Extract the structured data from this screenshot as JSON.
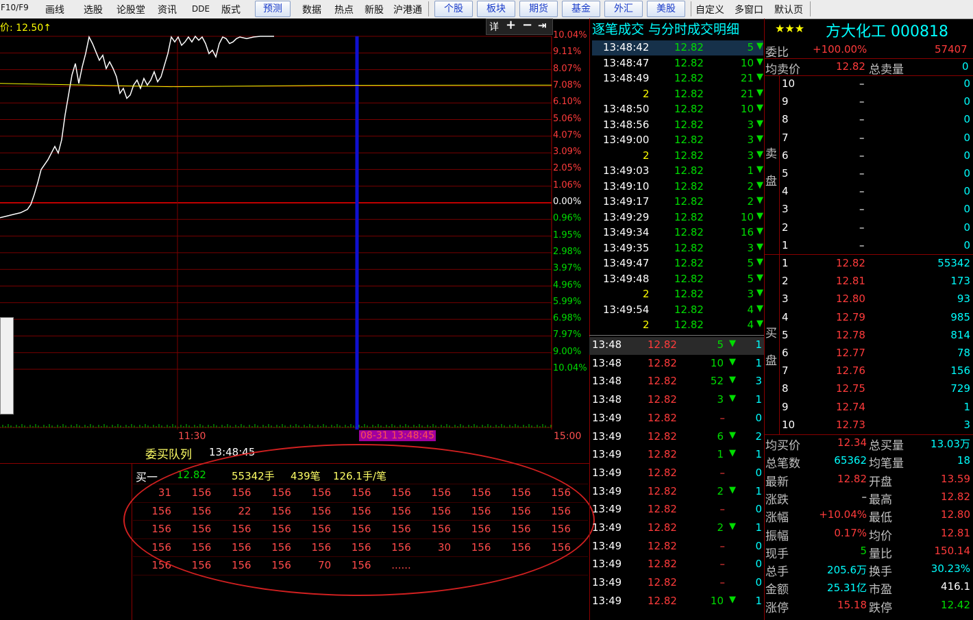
{
  "toolbar": {
    "items": [
      "F10/F9",
      "画线",
      "选股",
      "论股堂",
      "资讯",
      "DDE",
      "版式"
    ],
    "predict": "预测",
    "items2": [
      "数据",
      "热点",
      "新股",
      "沪港通"
    ],
    "tabs": [
      "个股",
      "板块",
      "期货",
      "基金",
      "外汇",
      "美股"
    ],
    "items3": [
      "自定义",
      "多窗口",
      "默认页"
    ]
  },
  "chart": {
    "price_label": "价: 12.50↑",
    "tools": [
      "详",
      "+",
      "−",
      "⇥"
    ],
    "time_labels": {
      "mid": "11:30",
      "cursor": "08-31 13:48:45",
      "end": "15:00"
    }
  },
  "chart_data": {
    "type": "line",
    "title": "",
    "y_pct_labels": [
      "10.04%",
      "9.11%",
      "8.07%",
      "7.08%",
      "6.10%",
      "5.06%",
      "4.07%",
      "3.09%",
      "2.05%",
      "1.06%",
      "0.00%",
      "0.96%",
      "1.95%",
      "2.98%",
      "3.97%",
      "4.96%",
      "5.99%",
      "6.98%",
      "7.97%",
      "9.00%",
      "10.04%"
    ],
    "x_labels": [
      "11:30",
      "15:00"
    ],
    "ylim": [
      -10.04,
      10.04
    ],
    "series": [
      {
        "name": "",
        "x": [
          0,
          10,
          20,
          30,
          40,
          45,
          50,
          55,
          60,
          70,
          80,
          85,
          90,
          95,
          100,
          105,
          110,
          115,
          120,
          125,
          130,
          135,
          140,
          145,
          150,
          155,
          160,
          165,
          170,
          175,
          180,
          185,
          190,
          195,
          200,
          205,
          210,
          215,
          220,
          225,
          230,
          235,
          240,
          245,
          250,
          255,
          260,
          265,
          270,
          275,
          280,
          285,
          290,
          295,
          300,
          305,
          310,
          315,
          320,
          325,
          330,
          335,
          340,
          345,
          350,
          360,
          370,
          380,
          390,
          400
        ],
        "values": [
          -0.9,
          -0.8,
          -0.7,
          -0.6,
          -0.4,
          -0.1,
          0.5,
          1.2,
          2.0,
          2.6,
          3.4,
          3.0,
          3.8,
          5.3,
          6.5,
          7.7,
          8.4,
          7.2,
          8.2,
          9.0,
          10.0,
          9.6,
          9.1,
          8.6,
          8.9,
          8.1,
          8.5,
          8.1,
          7.6,
          6.6,
          6.9,
          6.3,
          6.5,
          7.1,
          7.4,
          6.9,
          7.5,
          7.1,
          7.4,
          7.9,
          7.3,
          7.6,
          8.3,
          9.0,
          10.0,
          9.7,
          10.0,
          9.5,
          9.7,
          10.0,
          9.7,
          10.04,
          9.8,
          10.0,
          9.6,
          9.0,
          9.2,
          8.8,
          9.6,
          10.0,
          9.9,
          9.6,
          9.7,
          9.9,
          10.0,
          9.9,
          10.0,
          10.04,
          10.04,
          10.04
        ]
      },
      {
        "name": "",
        "x": [
          0,
          250,
          480,
          805
        ],
        "values": [
          7.2,
          7.0,
          7.08,
          7.1
        ]
      }
    ]
  },
  "queue": {
    "title": "委买队列",
    "time": "13:48:45",
    "label": "买一",
    "price": "12.82",
    "vol": "55342手",
    "count": "439笔",
    "avg": "126.1手/笔",
    "rows": [
      [
        "31",
        "156",
        "156",
        "156",
        "156",
        "156",
        "156",
        "156",
        "156",
        "156",
        "156"
      ],
      [
        "156",
        "156",
        "22",
        "156",
        "156",
        "156",
        "156",
        "156",
        "156",
        "156",
        "156"
      ],
      [
        "156",
        "156",
        "156",
        "156",
        "156",
        "156",
        "156",
        "156",
        "156",
        "156",
        "156"
      ],
      [
        "156",
        "156",
        "156",
        "156",
        "156",
        "156",
        "156",
        "30",
        "156",
        "156",
        "156"
      ],
      [
        "156",
        "156",
        "156",
        "156",
        "70",
        "156",
        "......"
      ]
    ]
  },
  "trades": {
    "header": "逐笔成交 与分时成交明细",
    "rows": [
      {
        "t": "13:48:42",
        "p": "12.82",
        "v": "5"
      },
      {
        "t": "13:48:47",
        "p": "12.82",
        "v": "10"
      },
      {
        "t": "13:48:49",
        "p": "12.82",
        "v": "21"
      },
      {
        "t": "2",
        "p": "12.82",
        "v": "21"
      },
      {
        "t": "13:48:50",
        "p": "12.82",
        "v": "10"
      },
      {
        "t": "13:48:56",
        "p": "12.82",
        "v": "3"
      },
      {
        "t": "13:49:00",
        "p": "12.82",
        "v": "3"
      },
      {
        "t": "2",
        "p": "12.82",
        "v": "3"
      },
      {
        "t": "13:49:03",
        "p": "12.82",
        "v": "1"
      },
      {
        "t": "13:49:10",
        "p": "12.82",
        "v": "2"
      },
      {
        "t": "13:49:17",
        "p": "12.82",
        "v": "2"
      },
      {
        "t": "13:49:29",
        "p": "12.82",
        "v": "10"
      },
      {
        "t": "13:49:34",
        "p": "12.82",
        "v": "16"
      },
      {
        "t": "13:49:35",
        "p": "12.82",
        "v": "3"
      },
      {
        "t": "13:49:47",
        "p": "12.82",
        "v": "5"
      },
      {
        "t": "13:49:48",
        "p": "12.82",
        "v": "5"
      },
      {
        "t": "2",
        "p": "12.82",
        "v": "3"
      },
      {
        "t": "13:49:54",
        "p": "12.82",
        "v": "4"
      },
      {
        "t": "2",
        "p": "12.82",
        "v": "4"
      }
    ],
    "minute_rows": [
      {
        "t": "13:48",
        "p": "12.82",
        "v": "5",
        "n": "1"
      },
      {
        "t": "13:48",
        "p": "12.82",
        "v": "10",
        "n": "1"
      },
      {
        "t": "13:48",
        "p": "12.82",
        "v": "52",
        "n": "3"
      },
      {
        "t": "13:48",
        "p": "12.82",
        "v": "3",
        "n": "1"
      },
      {
        "t": "13:49",
        "p": "12.82",
        "v": "–",
        "n": "0"
      },
      {
        "t": "13:49",
        "p": "12.82",
        "v": "6",
        "n": "2"
      },
      {
        "t": "13:49",
        "p": "12.82",
        "v": "1",
        "n": "1"
      },
      {
        "t": "13:49",
        "p": "12.82",
        "v": "–",
        "n": "0"
      },
      {
        "t": "13:49",
        "p": "12.82",
        "v": "2",
        "n": "1"
      },
      {
        "t": "13:49",
        "p": "12.82",
        "v": "–",
        "n": "0"
      },
      {
        "t": "13:49",
        "p": "12.82",
        "v": "2",
        "n": "1"
      },
      {
        "t": "13:49",
        "p": "12.82",
        "v": "–",
        "n": "0"
      },
      {
        "t": "13:49",
        "p": "12.82",
        "v": "–",
        "n": "0"
      },
      {
        "t": "13:49",
        "p": "12.82",
        "v": "–",
        "n": "0"
      },
      {
        "t": "13:49",
        "p": "12.82",
        "v": "10",
        "n": "1"
      }
    ]
  },
  "stock": {
    "stars": "★★★",
    "name": "方大化工 000818",
    "weibi_label": "委比",
    "weibi": "+100.00%",
    "weica": "57407",
    "avg_sell_label": "均卖价",
    "avg_sell": "12.82",
    "total_sell_label": "总卖量",
    "total_sell": "0",
    "sell_label_1": "卖",
    "sell_label_2": "盘",
    "buy_label_1": "买",
    "buy_label_2": "盘",
    "sell": [
      {
        "lvl": "10",
        "p": "–",
        "v": "0"
      },
      {
        "lvl": "9",
        "p": "–",
        "v": "0"
      },
      {
        "lvl": "8",
        "p": "–",
        "v": "0"
      },
      {
        "lvl": "7",
        "p": "–",
        "v": "0"
      },
      {
        "lvl": "6",
        "p": "–",
        "v": "0"
      },
      {
        "lvl": "5",
        "p": "–",
        "v": "0"
      },
      {
        "lvl": "4",
        "p": "–",
        "v": "0"
      },
      {
        "lvl": "3",
        "p": "–",
        "v": "0"
      },
      {
        "lvl": "2",
        "p": "–",
        "v": "0"
      },
      {
        "lvl": "1",
        "p": "–",
        "v": "0"
      }
    ],
    "buy": [
      {
        "lvl": "1",
        "p": "12.82",
        "v": "55342"
      },
      {
        "lvl": "2",
        "p": "12.81",
        "v": "173"
      },
      {
        "lvl": "3",
        "p": "12.80",
        "v": "93"
      },
      {
        "lvl": "4",
        "p": "12.79",
        "v": "985"
      },
      {
        "lvl": "5",
        "p": "12.78",
        "v": "814"
      },
      {
        "lvl": "6",
        "p": "12.77",
        "v": "78"
      },
      {
        "lvl": "7",
        "p": "12.76",
        "v": "156"
      },
      {
        "lvl": "8",
        "p": "12.75",
        "v": "729"
      },
      {
        "lvl": "9",
        "p": "12.74",
        "v": "1"
      },
      {
        "lvl": "10",
        "p": "12.73",
        "v": "3"
      }
    ],
    "stats": [
      {
        "l1": "均买价",
        "v1": "12.34",
        "l2": "总买量",
        "v2": "13.03万",
        "c1": "red",
        "c2": "cyan"
      },
      {
        "l1": "总笔数",
        "v1": "65362",
        "l2": "均笔量",
        "v2": "18",
        "c1": "cyan",
        "c2": "cyan"
      },
      {
        "l1": "最新",
        "v1": "12.82",
        "l2": "开盘",
        "v2": "13.59",
        "c1": "red",
        "c2": "red"
      },
      {
        "l1": "涨跌",
        "v1": "–",
        "l2": "最高",
        "v2": "12.82",
        "c1": "white",
        "c2": "red"
      },
      {
        "l1": "涨幅",
        "v1": "+10.04%",
        "l2": "最低",
        "v2": "12.80",
        "c1": "red",
        "c2": "red"
      },
      {
        "l1": "振幅",
        "v1": "0.17%",
        "l2": "均价",
        "v2": "12.81",
        "c1": "red",
        "c2": "red"
      },
      {
        "l1": "现手",
        "v1": "5",
        "l2": "量比",
        "v2": "150.14",
        "c1": "green",
        "c2": "red"
      },
      {
        "l1": "总手",
        "v1": "205.6万",
        "l2": "换手",
        "v2": "30.23%",
        "c1": "cyan",
        "c2": "cyan"
      },
      {
        "l1": "金额",
        "v1": "25.31亿",
        "l2": "市盈",
        "v2": "416.1",
        "c1": "cyan",
        "c2": "white"
      },
      {
        "l1": "涨停",
        "v1": "15.18",
        "l2": "跌停",
        "v2": "12.42",
        "c1": "red",
        "c2": "green"
      }
    ]
  }
}
